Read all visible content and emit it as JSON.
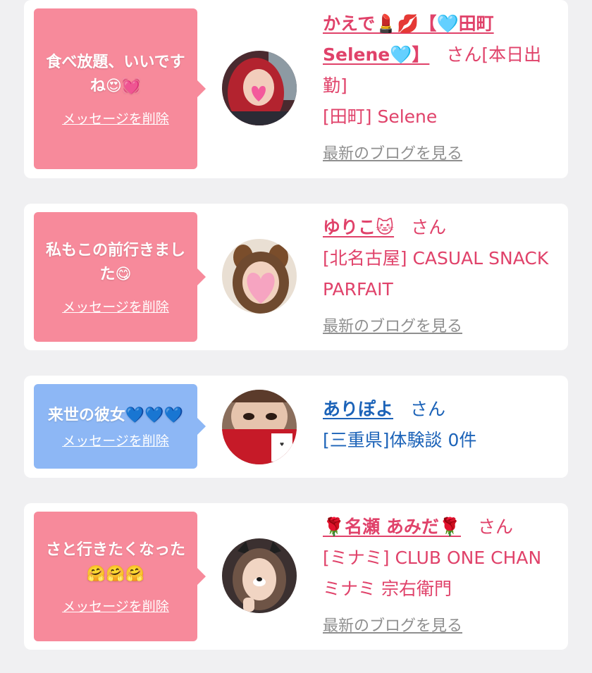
{
  "colors": {
    "pink_bubble": "#f78a9b",
    "blue_bubble": "#8db7f5",
    "pink_text": "#e0426a",
    "blue_text": "#1c63b8",
    "blog_link": "#8f8f8f",
    "page_bg": "#f0f0f2"
  },
  "messages": [
    {
      "text": "食べ放題、いいですね😍💓",
      "delete_label": "メッセージを削除",
      "name": "かえで💄💋【🩵田町Selene🩵】",
      "suffix": "さん[本日出勤]",
      "shop": "[田町] Selene",
      "blog_label": "最新のブログを見る",
      "theme": "pink"
    },
    {
      "text": "私もこの前行きました😋",
      "delete_label": "メッセージを削除",
      "name": "ゆりこ🐱",
      "suffix": "さん",
      "shop": "[北名古屋] CASUAL SNACK PARFAIT",
      "blog_label": "最新のブログを見る",
      "theme": "pink"
    },
    {
      "text": "来世の彼女💙💙💙",
      "delete_label": "メッセージを削除",
      "name": "ありぽよ",
      "suffix": "さん",
      "shop": "[三重県]体験談 0件",
      "theme": "blue"
    },
    {
      "text": "さと行きたくなった🤗🤗🤗",
      "delete_label": "メッセージを削除",
      "name": "🌹名瀬 あみだ🌹",
      "suffix": "さん",
      "shop": "[ミナミ] CLUB ONE CHAN ミナミ 宗右衛門",
      "blog_label": "最新のブログを見る",
      "theme": "pink"
    }
  ]
}
